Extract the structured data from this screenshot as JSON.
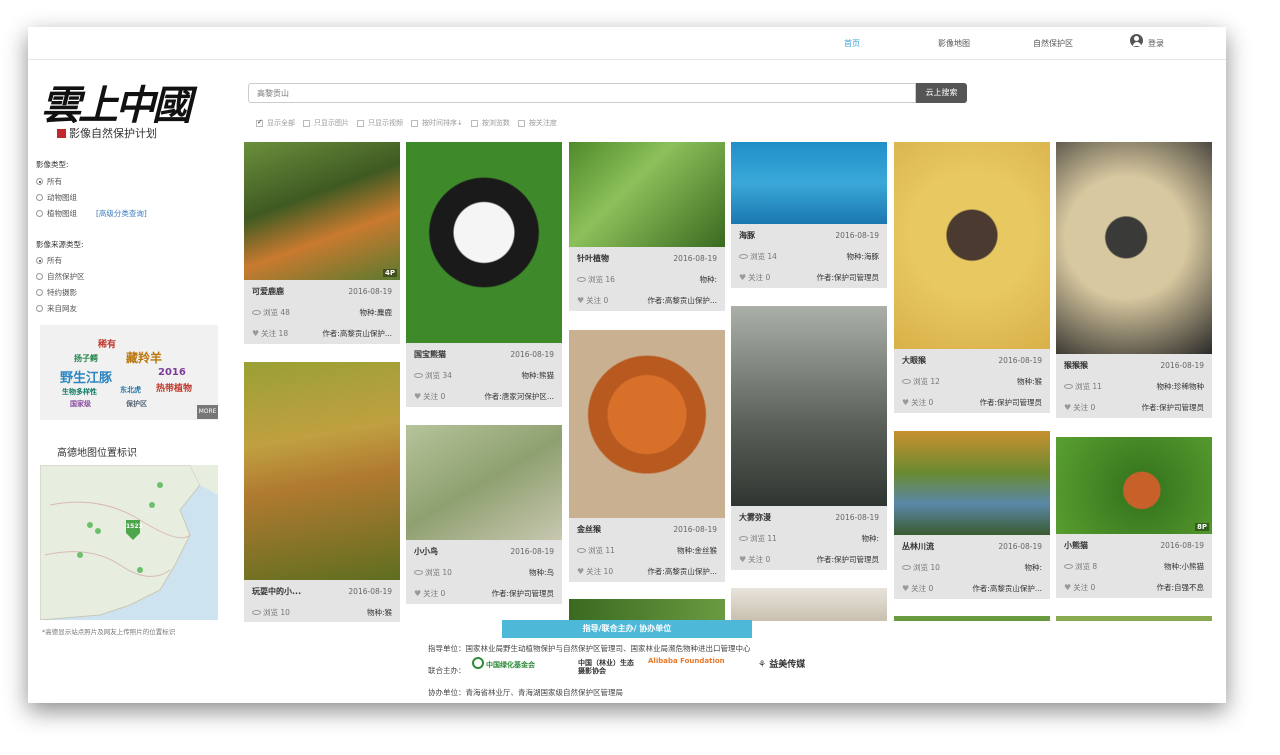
{
  "nav": {
    "home": "首页",
    "map": "影像地图",
    "reserve": "自然保护区",
    "login": "登录"
  },
  "logo": {
    "title": "雲上中國",
    "slogan": "影像自然保护计划"
  },
  "sidebar": {
    "type_label": "影像类型:",
    "type_options": [
      "所有",
      "动物图组",
      "植物图组"
    ],
    "advanced": "[高级分类查询]",
    "source_label": "影像来源类型:",
    "source_options": [
      "所有",
      "自然保护区",
      "特约摄影",
      "来自网友"
    ],
    "tagcloud": [
      "稀有",
      "野生江豚",
      "藏羚羊",
      "2016",
      "热带植物",
      "扬子鳄",
      "东北虎",
      "生物多样性",
      "国家级",
      "保护区"
    ],
    "more": "MORE",
    "map_title": "高德地图位置标识",
    "map_marker": "1523",
    "map_note": "*高德显示站点照片及网友上传照片的位置标识"
  },
  "search": {
    "placeholder": "高黎贡山",
    "button": "云上搜索"
  },
  "filters": [
    "显示全部",
    "只显示图片",
    "只显示视频",
    "按时间排序↓",
    "按浏览数",
    "按关注度"
  ],
  "cards": [
    {
      "title": "可爱鹿鹿",
      "date": "2016-08-19",
      "views": "浏览 48",
      "species": "物种:麋鹿",
      "likes": "关注 18",
      "author": "作者:高黎贡山保护...",
      "badge": "4P"
    },
    {
      "title": "玩耍中的小...",
      "date": "2016-08-19",
      "views": "浏览 10",
      "species": "物种:猴",
      "likes": "",
      "author": "",
      "badge": ""
    },
    {
      "title": "国宝熊猫",
      "date": "2016-08-19",
      "views": "浏览 34",
      "species": "物种:熊猫",
      "likes": "关注 0",
      "author": "作者:唐家河保护区...",
      "badge": ""
    },
    {
      "title": "小小鸟",
      "date": "2016-08-19",
      "views": "浏览 10",
      "species": "物种:鸟",
      "likes": "关注 0",
      "author": "作者:保护司管理员",
      "badge": ""
    },
    {
      "title": "针叶植物",
      "date": "2016-08-19",
      "views": "浏览 16",
      "species": "物种:",
      "likes": "关注 0",
      "author": "作者:高黎贡山保护...",
      "badge": ""
    },
    {
      "title": "金丝猴",
      "date": "2016-08-19",
      "views": "浏览 11",
      "species": "物种:金丝猴",
      "likes": "关注 10",
      "author": "作者:高黎贡山保护...",
      "badge": ""
    },
    {
      "title": "海豚",
      "date": "2016-08-19",
      "views": "浏览 14",
      "species": "物种:海豚",
      "likes": "关注 0",
      "author": "作者:保护司管理员",
      "badge": ""
    },
    {
      "title": "大雾弥漫",
      "date": "2016-08-19",
      "views": "浏览 11",
      "species": "物种:",
      "likes": "关注 0",
      "author": "作者:保护司管理员",
      "badge": ""
    },
    {
      "title": "大眼猴",
      "date": "2016-08-19",
      "views": "浏览 12",
      "species": "物种:猴",
      "likes": "关注 0",
      "author": "作者:保护司管理员",
      "badge": ""
    },
    {
      "title": "丛林川流",
      "date": "2016-08-19",
      "views": "浏览 10",
      "species": "物种:",
      "likes": "关注 0",
      "author": "作者:高黎贡山保护...",
      "badge": ""
    },
    {
      "title": "猴猴猴",
      "date": "2016-08-19",
      "views": "浏览 11",
      "species": "物种:珍稀物种",
      "likes": "关注 0",
      "author": "作者:保护司管理员",
      "badge": ""
    },
    {
      "title": "小熊猫",
      "date": "2016-08-19",
      "views": "浏览 8",
      "species": "物种:小熊猫",
      "likes": "关注 0",
      "author": "作者:自强不息",
      "badge": "8P"
    }
  ],
  "footer": {
    "banner": "指导/联合主办/ 协办单位",
    "guide": "指导单位：国家林业局野生动植物保护与自然保护区管理司、国家林业局濒危物种进出口管理中心",
    "host_label": "联合主办：",
    "sponsors": [
      "中国绿化基金会",
      "中国（林业）生态摄影协会",
      "Alibaba Foundation",
      "益美传媒"
    ],
    "co": "协办单位：青海省林业厅、青海湖国家级自然保护区管理局"
  },
  "colors": {
    "accent": "#4db8d7",
    "card_bg": "#e4e4e4",
    "button": "#555555"
  }
}
